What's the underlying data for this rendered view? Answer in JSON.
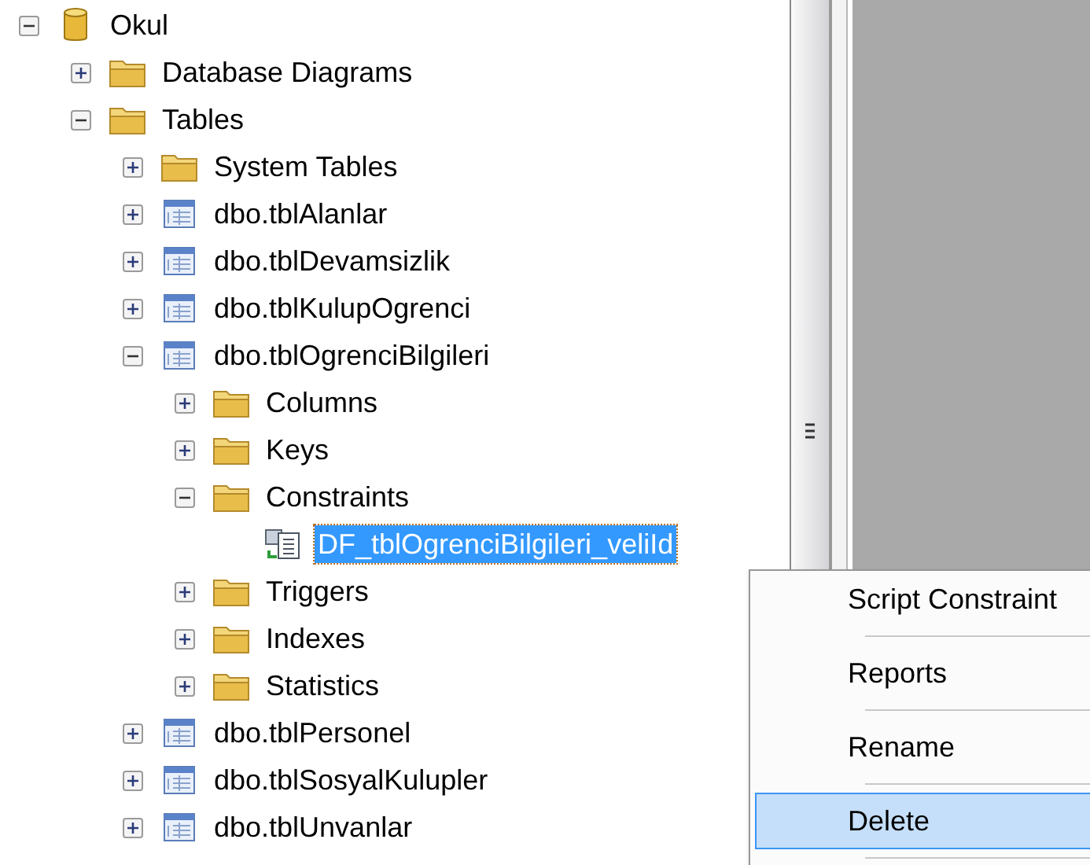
{
  "tree": [
    {
      "label": "Okul",
      "kind": "database",
      "expanded": true,
      "selected": false,
      "children": [
        {
          "label": "Database Diagrams",
          "kind": "folder",
          "expanded": false,
          "selected": false
        },
        {
          "label": "Tables",
          "kind": "folder",
          "expanded": true,
          "selected": false,
          "children": [
            {
              "label": "System Tables",
              "kind": "folder",
              "expanded": false,
              "selected": false
            },
            {
              "label": "dbo.tblAlanlar",
              "kind": "table",
              "expanded": false,
              "selected": false
            },
            {
              "label": "dbo.tblDevamsizlik",
              "kind": "table",
              "expanded": false,
              "selected": false
            },
            {
              "label": "dbo.tblKulupOgrenci",
              "kind": "table",
              "expanded": false,
              "selected": false
            },
            {
              "label": "dbo.tblOgrenciBilgileri",
              "kind": "table",
              "expanded": true,
              "selected": false,
              "children": [
                {
                  "label": "Columns",
                  "kind": "folder",
                  "expanded": false,
                  "selected": false
                },
                {
                  "label": "Keys",
                  "kind": "folder",
                  "expanded": false,
                  "selected": false
                },
                {
                  "label": "Constraints",
                  "kind": "folder",
                  "expanded": true,
                  "selected": false,
                  "children": [
                    {
                      "label": "DF_tblOgrenciBilgileri_veliId",
                      "kind": "constraint",
                      "selected": true
                    }
                  ]
                },
                {
                  "label": "Triggers",
                  "kind": "folder",
                  "expanded": false,
                  "selected": false
                },
                {
                  "label": "Indexes",
                  "kind": "folder",
                  "expanded": false,
                  "selected": false
                },
                {
                  "label": "Statistics",
                  "kind": "folder",
                  "expanded": false,
                  "selected": false
                }
              ]
            },
            {
              "label": "dbo.tblPersonel",
              "kind": "table",
              "expanded": false,
              "selected": false
            },
            {
              "label": "dbo.tblSosyalKulupler",
              "kind": "table",
              "expanded": false,
              "selected": false
            },
            {
              "label": "dbo.tblUnvanlar",
              "kind": "table",
              "expanded": false,
              "selected": false
            }
          ]
        }
      ]
    }
  ],
  "context_menu": [
    {
      "label": "Script Constraint",
      "selected": false
    },
    {
      "label": "Reports",
      "selected": false
    },
    {
      "label": "Rename",
      "selected": false
    },
    {
      "label": "Delete",
      "selected": true
    }
  ]
}
